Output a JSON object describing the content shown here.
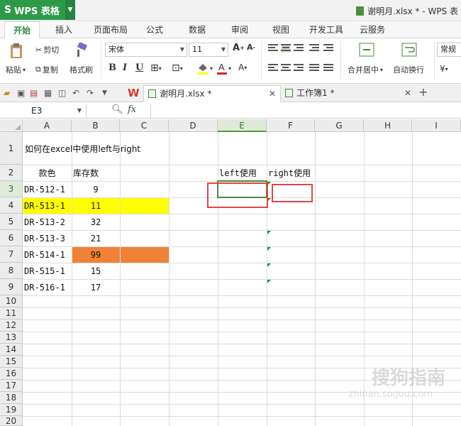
{
  "app": {
    "name": "WPS 表格",
    "window_title": "谢明月.xlsx * - WPS 表"
  },
  "menu": {
    "tabs": [
      "开始",
      "插入",
      "页面布局",
      "公式",
      "数据",
      "审阅",
      "视图",
      "开发工具",
      "云服务"
    ],
    "active": "开始"
  },
  "ribbon": {
    "paste": "粘贴",
    "cut": "剪切",
    "copy": "复制",
    "format_painter": "格式刷",
    "font_name": "宋体",
    "font_size": "11",
    "merge_center": "合并居中",
    "wrap_text": "自动换行",
    "number_format": "常规"
  },
  "doc_tabs": [
    {
      "label": "谢明月.xlsx *",
      "active": true
    },
    {
      "label": "工作簿1 *",
      "active": false
    }
  ],
  "formula_bar": {
    "name_box": "E3",
    "fx": "fx",
    "formula": ""
  },
  "columns": [
    "A",
    "B",
    "C",
    "D",
    "E",
    "F",
    "G",
    "H",
    "I"
  ],
  "selected_column": "E",
  "rows": [
    "1",
    "2",
    "3",
    "4",
    "5",
    "6",
    "7",
    "8",
    "9",
    "10",
    "11",
    "12",
    "13",
    "14",
    "15",
    "16",
    "17",
    "18",
    "19",
    "20"
  ],
  "selected_row": "3",
  "sheet": {
    "title": "如何在excel中使用left与right",
    "header_color": "款色",
    "header_stock": "库存数",
    "header_left": "left使用",
    "header_right": "right使用",
    "data": [
      {
        "code": "DR-512-1",
        "qty": "9"
      },
      {
        "code": "DR-513-1",
        "qty": "11"
      },
      {
        "code": "DR-513-2",
        "qty": "32"
      },
      {
        "code": "DR-513-3",
        "qty": "21"
      },
      {
        "code": "DR-514-1",
        "qty": "99"
      },
      {
        "code": "DR-515-1",
        "qty": "15"
      },
      {
        "code": "DR-516-1",
        "qty": "17"
      }
    ]
  },
  "colors": {
    "brand_green": "#2d9a4a",
    "highlight_yellow": "#ffff00",
    "highlight_orange": "#f08236",
    "annotation_red": "#e04646"
  },
  "watermark": {
    "line1": "搜狗指南",
    "line2": "zhinan.sogou.com"
  }
}
